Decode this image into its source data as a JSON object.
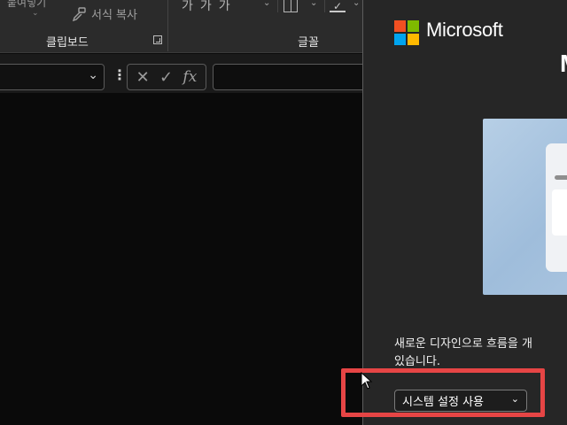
{
  "ribbon": {
    "clipboard_top_partial": "붙여넣기",
    "format_painter_label": "서식 복사",
    "clipboard_group_label": "클립보드",
    "font_group_label": "글꼴",
    "font_buttons": [
      "가",
      "가",
      "가"
    ]
  },
  "formula_bar": {
    "cancel_glyph": "✕",
    "enter_glyph": "✓",
    "fx_label": "fx"
  },
  "panel": {
    "brand": "Microsoft",
    "title_partial": "M",
    "description_line1": "새로운 디자인으로 흐름을 개",
    "description_line2": "있습니다.",
    "theme_select_value": "시스템 설정 사용",
    "logo_colors": [
      "#f25022",
      "#7fba00",
      "#00a4ef",
      "#ffb900"
    ]
  },
  "highlight_color": "#e64545"
}
